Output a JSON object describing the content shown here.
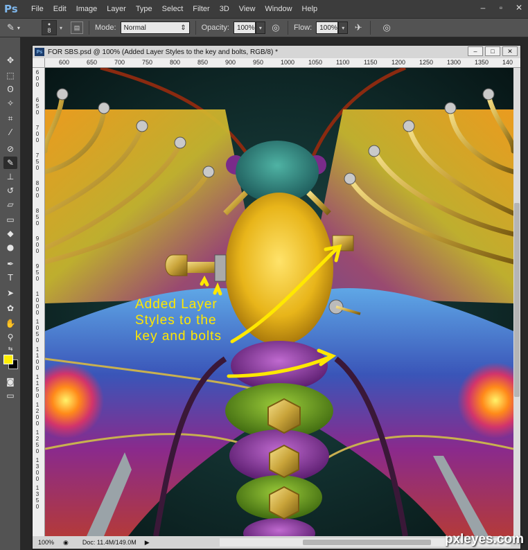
{
  "app": {
    "logo": "Ps"
  },
  "menu": [
    "File",
    "Edit",
    "Image",
    "Layer",
    "Type",
    "Select",
    "Filter",
    "3D",
    "View",
    "Window",
    "Help"
  ],
  "options_bar": {
    "brush_size": "8",
    "mode_label": "Mode:",
    "mode_value": "Normal",
    "opacity_label": "Opacity:",
    "opacity_value": "100%",
    "flow_label": "Flow:",
    "flow_value": "100%"
  },
  "document": {
    "title": "FOR SBS.psd @ 100% (Added Layer Styles to the  key and bolts, RGB/8) *",
    "zoom": "100%",
    "doc_size": "Doc: 11.4M/149.0M"
  },
  "ruler": {
    "top": [
      "600",
      "650",
      "700",
      "750",
      "800",
      "850",
      "900",
      "950",
      "1000",
      "1050",
      "1100",
      "1150",
      "1200",
      "1250",
      "1300",
      "1350",
      "140"
    ],
    "left": [
      "600",
      "650",
      "700",
      "750",
      "800",
      "850",
      "900",
      "950",
      "1000",
      "1050",
      "1100",
      "1150",
      "1200",
      "1250",
      "1300",
      "1350"
    ]
  },
  "annotation": {
    "line1": "Added Layer",
    "line2": "Styles to the",
    "line3": "key and bolts"
  },
  "watermark": "pxleyes.com",
  "colors": {
    "foreground": "#ffee00",
    "background": "#000000",
    "annotation": "#ffe800"
  },
  "tools": [
    "move-icon",
    "marquee-icon",
    "lasso-icon",
    "magic-wand-icon",
    "crop-icon",
    "eyedropper-icon",
    "healing-brush-icon",
    "brush-icon",
    "clone-stamp-icon",
    "history-brush-icon",
    "eraser-icon",
    "gradient-icon",
    "blur-icon",
    "dodge-icon",
    "pen-icon",
    "type-icon",
    "path-selection-icon",
    "shape-icon",
    "hand-icon",
    "zoom-icon"
  ]
}
